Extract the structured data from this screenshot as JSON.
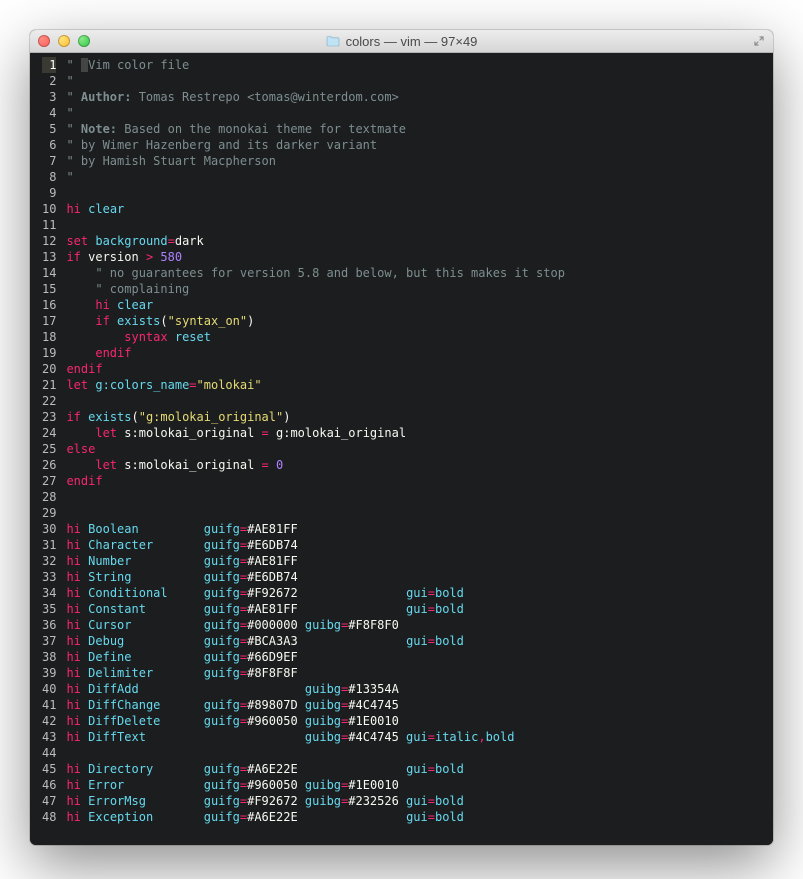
{
  "window": {
    "title": "colors — vim — 97×49"
  },
  "lines": [
    {
      "n": 1,
      "tokens": [
        [
          "c",
          "\" "
        ],
        [
          "cursorcol",
          " "
        ],
        [
          "c",
          "Vim color file"
        ]
      ]
    },
    {
      "n": 2,
      "tokens": [
        [
          "c",
          "\""
        ]
      ]
    },
    {
      "n": 3,
      "tokens": [
        [
          "c",
          "\" "
        ],
        [
          "cb",
          "Author:"
        ],
        [
          "c",
          " Tomas Restrepo <tomas@winterdom.com>"
        ]
      ]
    },
    {
      "n": 4,
      "tokens": [
        [
          "c",
          "\""
        ]
      ]
    },
    {
      "n": 5,
      "tokens": [
        [
          "c",
          "\" "
        ],
        [
          "cb",
          "Note:"
        ],
        [
          "c",
          " Based on the monokai theme for textmate"
        ]
      ]
    },
    {
      "n": 6,
      "tokens": [
        [
          "c",
          "\" by Wimer Hazenberg and its darker variant"
        ]
      ]
    },
    {
      "n": 7,
      "tokens": [
        [
          "c",
          "\" by Hamish Stuart Macpherson"
        ]
      ]
    },
    {
      "n": 8,
      "tokens": [
        [
          "c",
          "\""
        ]
      ]
    },
    {
      "n": 9,
      "tokens": []
    },
    {
      "n": 10,
      "tokens": [
        [
          "kw",
          "hi"
        ],
        [
          "id",
          " "
        ],
        [
          "fn",
          "clear"
        ]
      ]
    },
    {
      "n": 11,
      "tokens": []
    },
    {
      "n": 12,
      "tokens": [
        [
          "kw",
          "set"
        ],
        [
          "id",
          " "
        ],
        [
          "fn",
          "background"
        ],
        [
          "kw",
          "="
        ],
        [
          "id",
          "dark"
        ]
      ]
    },
    {
      "n": 13,
      "tokens": [
        [
          "kw",
          "if"
        ],
        [
          "id",
          " version "
        ],
        [
          "kw",
          ">"
        ],
        [
          "id",
          " "
        ],
        [
          "num",
          "580"
        ]
      ]
    },
    {
      "n": 14,
      "tokens": [
        [
          "id",
          "    "
        ],
        [
          "c",
          "\" no guarantees for version 5.8 and below, but this makes it stop"
        ]
      ]
    },
    {
      "n": 15,
      "tokens": [
        [
          "id",
          "    "
        ],
        [
          "c",
          "\" complaining"
        ]
      ]
    },
    {
      "n": 16,
      "tokens": [
        [
          "id",
          "    "
        ],
        [
          "kw",
          "hi"
        ],
        [
          "id",
          " "
        ],
        [
          "fn",
          "clear"
        ]
      ]
    },
    {
      "n": 17,
      "tokens": [
        [
          "id",
          "    "
        ],
        [
          "kw",
          "if"
        ],
        [
          "id",
          " "
        ],
        [
          "fn",
          "exists"
        ],
        [
          "id",
          "("
        ],
        [
          "str",
          "\"syntax_on\""
        ],
        [
          "id",
          ")"
        ]
      ]
    },
    {
      "n": 18,
      "tokens": [
        [
          "id",
          "        "
        ],
        [
          "kw",
          "syntax"
        ],
        [
          "id",
          " "
        ],
        [
          "fn",
          "reset"
        ]
      ]
    },
    {
      "n": 19,
      "tokens": [
        [
          "id",
          "    "
        ],
        [
          "kw",
          "endif"
        ]
      ]
    },
    {
      "n": 20,
      "tokens": [
        [
          "kw",
          "endif"
        ]
      ]
    },
    {
      "n": 21,
      "tokens": [
        [
          "kw",
          "let"
        ],
        [
          "id",
          " "
        ],
        [
          "fn",
          "g:colors_name"
        ],
        [
          "kw",
          "="
        ],
        [
          "str",
          "\"molokai\""
        ]
      ]
    },
    {
      "n": 22,
      "tokens": []
    },
    {
      "n": 23,
      "tokens": [
        [
          "kw",
          "if"
        ],
        [
          "id",
          " "
        ],
        [
          "fn",
          "exists"
        ],
        [
          "id",
          "("
        ],
        [
          "str",
          "\"g:molokai_original\""
        ],
        [
          "id",
          ")"
        ]
      ]
    },
    {
      "n": 24,
      "tokens": [
        [
          "id",
          "    "
        ],
        [
          "kw",
          "let"
        ],
        [
          "id",
          " s:molokai_original "
        ],
        [
          "kw",
          "="
        ],
        [
          "id",
          " g:molokai_original"
        ]
      ]
    },
    {
      "n": 25,
      "tokens": [
        [
          "kw",
          "else"
        ]
      ]
    },
    {
      "n": 26,
      "tokens": [
        [
          "id",
          "    "
        ],
        [
          "kw",
          "let"
        ],
        [
          "id",
          " s:molokai_original "
        ],
        [
          "kw",
          "="
        ],
        [
          "id",
          " "
        ],
        [
          "num",
          "0"
        ]
      ]
    },
    {
      "n": 27,
      "tokens": [
        [
          "kw",
          "endif"
        ]
      ]
    },
    {
      "n": 28,
      "tokens": []
    },
    {
      "n": 29,
      "tokens": []
    },
    {
      "n": 30,
      "tokens": [
        [
          "kw",
          "hi"
        ],
        [
          "id",
          " "
        ],
        [
          "fn",
          "Boolean"
        ],
        [
          "id",
          "         "
        ],
        [
          "fn",
          "guifg"
        ],
        [
          "kw",
          "="
        ],
        [
          "id",
          "#AE81FF"
        ]
      ]
    },
    {
      "n": 31,
      "tokens": [
        [
          "kw",
          "hi"
        ],
        [
          "id",
          " "
        ],
        [
          "fn",
          "Character"
        ],
        [
          "id",
          "       "
        ],
        [
          "fn",
          "guifg"
        ],
        [
          "kw",
          "="
        ],
        [
          "id",
          "#E6DB74"
        ]
      ]
    },
    {
      "n": 32,
      "tokens": [
        [
          "kw",
          "hi"
        ],
        [
          "id",
          " "
        ],
        [
          "fn",
          "Number"
        ],
        [
          "id",
          "          "
        ],
        [
          "fn",
          "guifg"
        ],
        [
          "kw",
          "="
        ],
        [
          "id",
          "#AE81FF"
        ]
      ]
    },
    {
      "n": 33,
      "tokens": [
        [
          "kw",
          "hi"
        ],
        [
          "id",
          " "
        ],
        [
          "fn",
          "String"
        ],
        [
          "id",
          "          "
        ],
        [
          "fn",
          "guifg"
        ],
        [
          "kw",
          "="
        ],
        [
          "id",
          "#E6DB74"
        ]
      ]
    },
    {
      "n": 34,
      "tokens": [
        [
          "kw",
          "hi"
        ],
        [
          "id",
          " "
        ],
        [
          "fn",
          "Conditional"
        ],
        [
          "id",
          "     "
        ],
        [
          "fn",
          "guifg"
        ],
        [
          "kw",
          "="
        ],
        [
          "id",
          "#F92672               "
        ],
        [
          "fn",
          "gui"
        ],
        [
          "kw",
          "="
        ],
        [
          "fn",
          "bold"
        ]
      ]
    },
    {
      "n": 35,
      "tokens": [
        [
          "kw",
          "hi"
        ],
        [
          "id",
          " "
        ],
        [
          "fn",
          "Constant"
        ],
        [
          "id",
          "        "
        ],
        [
          "fn",
          "guifg"
        ],
        [
          "kw",
          "="
        ],
        [
          "id",
          "#AE81FF               "
        ],
        [
          "fn",
          "gui"
        ],
        [
          "kw",
          "="
        ],
        [
          "fn",
          "bold"
        ]
      ]
    },
    {
      "n": 36,
      "tokens": [
        [
          "kw",
          "hi"
        ],
        [
          "id",
          " "
        ],
        [
          "fn",
          "Cursor"
        ],
        [
          "id",
          "          "
        ],
        [
          "fn",
          "guifg"
        ],
        [
          "kw",
          "="
        ],
        [
          "id",
          "#000000 "
        ],
        [
          "fn",
          "guibg"
        ],
        [
          "kw",
          "="
        ],
        [
          "id",
          "#F8F8F0"
        ]
      ]
    },
    {
      "n": 37,
      "tokens": [
        [
          "kw",
          "hi"
        ],
        [
          "id",
          " "
        ],
        [
          "fn",
          "Debug"
        ],
        [
          "id",
          "           "
        ],
        [
          "fn",
          "guifg"
        ],
        [
          "kw",
          "="
        ],
        [
          "id",
          "#BCA3A3               "
        ],
        [
          "fn",
          "gui"
        ],
        [
          "kw",
          "="
        ],
        [
          "fn",
          "bold"
        ]
      ]
    },
    {
      "n": 38,
      "tokens": [
        [
          "kw",
          "hi"
        ],
        [
          "id",
          " "
        ],
        [
          "fn",
          "Define"
        ],
        [
          "id",
          "          "
        ],
        [
          "fn",
          "guifg"
        ],
        [
          "kw",
          "="
        ],
        [
          "id",
          "#66D9EF"
        ]
      ]
    },
    {
      "n": 39,
      "tokens": [
        [
          "kw",
          "hi"
        ],
        [
          "id",
          " "
        ],
        [
          "fn",
          "Delimiter"
        ],
        [
          "id",
          "       "
        ],
        [
          "fn",
          "guifg"
        ],
        [
          "kw",
          "="
        ],
        [
          "id",
          "#8F8F8F"
        ]
      ]
    },
    {
      "n": 40,
      "tokens": [
        [
          "kw",
          "hi"
        ],
        [
          "id",
          " "
        ],
        [
          "fn",
          "DiffAdd"
        ],
        [
          "id",
          "                       "
        ],
        [
          "fn",
          "guibg"
        ],
        [
          "kw",
          "="
        ],
        [
          "id",
          "#13354A"
        ]
      ]
    },
    {
      "n": 41,
      "tokens": [
        [
          "kw",
          "hi"
        ],
        [
          "id",
          " "
        ],
        [
          "fn",
          "DiffChange"
        ],
        [
          "id",
          "      "
        ],
        [
          "fn",
          "guifg"
        ],
        [
          "kw",
          "="
        ],
        [
          "id",
          "#89807D "
        ],
        [
          "fn",
          "guibg"
        ],
        [
          "kw",
          "="
        ],
        [
          "id",
          "#4C4745"
        ]
      ]
    },
    {
      "n": 42,
      "tokens": [
        [
          "kw",
          "hi"
        ],
        [
          "id",
          " "
        ],
        [
          "fn",
          "DiffDelete"
        ],
        [
          "id",
          "      "
        ],
        [
          "fn",
          "guifg"
        ],
        [
          "kw",
          "="
        ],
        [
          "id",
          "#960050 "
        ],
        [
          "fn",
          "guibg"
        ],
        [
          "kw",
          "="
        ],
        [
          "id",
          "#1E0010"
        ]
      ]
    },
    {
      "n": 43,
      "tokens": [
        [
          "kw",
          "hi"
        ],
        [
          "id",
          " "
        ],
        [
          "fn",
          "DiffText"
        ],
        [
          "id",
          "                      "
        ],
        [
          "fn",
          "guibg"
        ],
        [
          "kw",
          "="
        ],
        [
          "id",
          "#4C4745 "
        ],
        [
          "fn",
          "gui"
        ],
        [
          "kw",
          "="
        ],
        [
          "fn",
          "italic"
        ],
        [
          "kw",
          ","
        ],
        [
          "fn",
          "bold"
        ]
      ]
    },
    {
      "n": 44,
      "tokens": []
    },
    {
      "n": 45,
      "tokens": [
        [
          "kw",
          "hi"
        ],
        [
          "id",
          " "
        ],
        [
          "fn",
          "Directory"
        ],
        [
          "id",
          "       "
        ],
        [
          "fn",
          "guifg"
        ],
        [
          "kw",
          "="
        ],
        [
          "id",
          "#A6E22E               "
        ],
        [
          "fn",
          "gui"
        ],
        [
          "kw",
          "="
        ],
        [
          "fn",
          "bold"
        ]
      ]
    },
    {
      "n": 46,
      "tokens": [
        [
          "kw",
          "hi"
        ],
        [
          "id",
          " "
        ],
        [
          "fn",
          "Error"
        ],
        [
          "id",
          "           "
        ],
        [
          "fn",
          "guifg"
        ],
        [
          "kw",
          "="
        ],
        [
          "id",
          "#960050 "
        ],
        [
          "fn",
          "guibg"
        ],
        [
          "kw",
          "="
        ],
        [
          "id",
          "#1E0010"
        ]
      ]
    },
    {
      "n": 47,
      "tokens": [
        [
          "kw",
          "hi"
        ],
        [
          "id",
          " "
        ],
        [
          "fn",
          "ErrorMsg"
        ],
        [
          "id",
          "        "
        ],
        [
          "fn",
          "guifg"
        ],
        [
          "kw",
          "="
        ],
        [
          "id",
          "#F92672 "
        ],
        [
          "fn",
          "guibg"
        ],
        [
          "kw",
          "="
        ],
        [
          "id",
          "#232526 "
        ],
        [
          "fn",
          "gui"
        ],
        [
          "kw",
          "="
        ],
        [
          "fn",
          "bold"
        ]
      ]
    },
    {
      "n": 48,
      "tokens": [
        [
          "kw",
          "hi"
        ],
        [
          "id",
          " "
        ],
        [
          "fn",
          "Exception"
        ],
        [
          "id",
          "       "
        ],
        [
          "fn",
          "guifg"
        ],
        [
          "kw",
          "="
        ],
        [
          "id",
          "#A6E22E               "
        ],
        [
          "fn",
          "gui"
        ],
        [
          "kw",
          "="
        ],
        [
          "fn",
          "bold"
        ]
      ]
    }
  ]
}
